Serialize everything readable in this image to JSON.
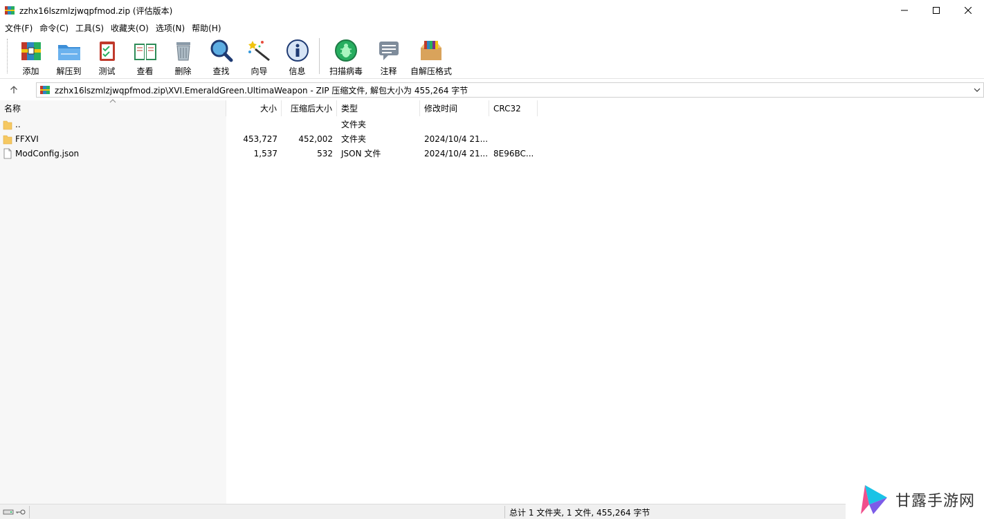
{
  "window": {
    "title": "zzhx16lszmlzjwqpfmod.zip (评估版本)",
    "controls": [
      "minimize",
      "maximize",
      "close"
    ]
  },
  "menu": [
    "文件(F)",
    "命令(C)",
    "工具(S)",
    "收藏夹(O)",
    "选项(N)",
    "帮助(H)"
  ],
  "toolbar": {
    "buttons": [
      {
        "label": "添加",
        "icon": "add-archive-icon"
      },
      {
        "label": "解压到",
        "icon": "extract-to-icon"
      },
      {
        "label": "测试",
        "icon": "test-icon"
      },
      {
        "label": "查看",
        "icon": "view-book-icon"
      },
      {
        "label": "删除",
        "icon": "trash-icon"
      },
      {
        "label": "查找",
        "icon": "magnifier-icon"
      },
      {
        "label": "向导",
        "icon": "wizard-wand-icon"
      },
      {
        "label": "信息",
        "icon": "info-icon"
      },
      {
        "label": "扫描病毒",
        "icon": "virus-scan-icon"
      },
      {
        "label": "注释",
        "icon": "comment-icon"
      },
      {
        "label": "自解压格式",
        "icon": "sfx-box-icon"
      }
    ]
  },
  "address": {
    "path": "zzhx16lszmlzjwqpfmod.zip\\XVI.EmeraldGreen.UltimaWeapon - ZIP 压缩文件, 解包大小为 455,264 字节"
  },
  "columns": [
    "名称",
    "大小",
    "压缩后大小",
    "类型",
    "修改时间",
    "CRC32"
  ],
  "files": [
    {
      "name": "..",
      "size": "",
      "packed": "",
      "type": "文件夹",
      "modified": "",
      "crc": "",
      "kind": "folder"
    },
    {
      "name": "FFXVI",
      "size": "453,727",
      "packed": "452,002",
      "type": "文件夹",
      "modified": "2024/10/4 21...",
      "crc": "",
      "kind": "folder"
    },
    {
      "name": "ModConfig.json",
      "size": "1,537",
      "packed": "532",
      "type": "JSON 文件",
      "modified": "2024/10/4 21...",
      "crc": "8E96BC...",
      "kind": "file"
    }
  ],
  "status": {
    "summary": "总计 1 文件夹, 1 文件, 455,264 字节"
  },
  "watermark": {
    "text": "甘露手游网"
  },
  "colors": {
    "folder": "#f5c862",
    "folder_dark": "#e0a838",
    "name_column_bg": "#f7f7f7",
    "statusbar_bg": "#f0f0f0"
  }
}
